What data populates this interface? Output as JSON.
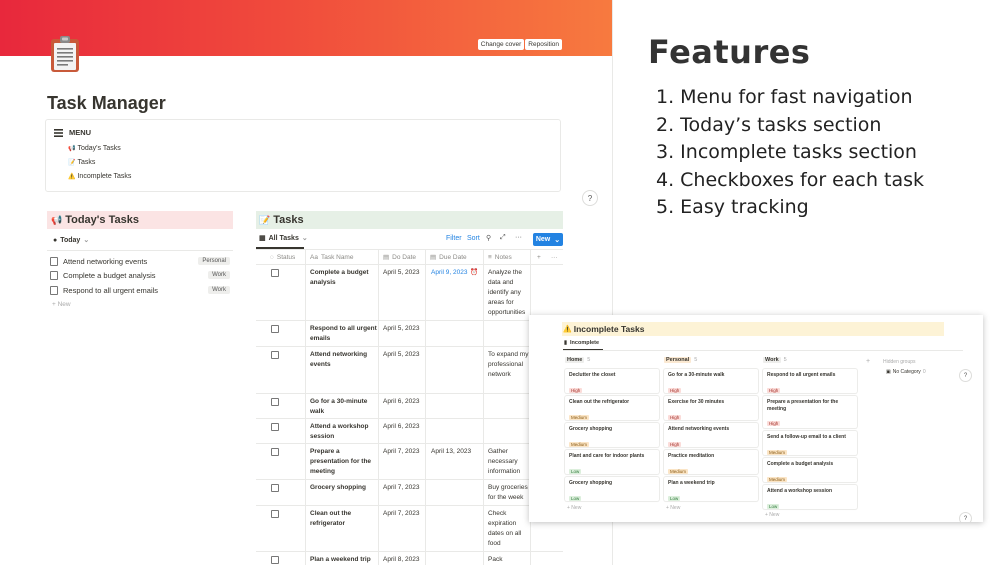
{
  "cover": {
    "change_cover": "Change cover",
    "reposition": "Reposition"
  },
  "page": {
    "title": "Task Manager"
  },
  "menu": {
    "label": "MENU",
    "links": [
      {
        "icon": "📢",
        "label": "Today's Tasks"
      },
      {
        "icon": "📝",
        "label": "Tasks"
      },
      {
        "icon": "⚠️",
        "label": "Incomplete Tasks"
      }
    ]
  },
  "help": "?",
  "today": {
    "icon": "📢",
    "title": "Today's Tasks",
    "filter": "Today",
    "rows": [
      {
        "name": "Attend networking events",
        "tag": "Personal"
      },
      {
        "name": "Complete a budget analysis",
        "tag": "Work"
      },
      {
        "name": "Respond to all urgent emails",
        "tag": "Work"
      }
    ],
    "new_label": "+ New"
  },
  "tasks": {
    "icon": "📝",
    "title": "Tasks",
    "view": "All Tasks",
    "filter": "Filter",
    "sort": "Sort",
    "new_button": "New",
    "columns": {
      "status": "Status",
      "name": "Task Name",
      "do_date": "Do Date",
      "due_date": "Due Date",
      "notes": "Notes",
      "plus": "+",
      "more": "···"
    },
    "rows": [
      {
        "name": "Complete a budget analysis",
        "do": "April 5, 2023",
        "due": "April 9, 2023",
        "notes": "Analyze the data and identify any areas for opportunities"
      },
      {
        "name": "Respond to all urgent emails",
        "do": "April 5, 2023",
        "due": "",
        "notes": ""
      },
      {
        "name": "Attend networking events",
        "do": "April 5, 2023",
        "due": "",
        "notes": "To expand my professional network"
      },
      {
        "name": "Go for a 30-minute walk",
        "do": "April 6, 2023",
        "due": "",
        "notes": ""
      },
      {
        "name": "Attend a workshop session",
        "do": "April 6, 2023",
        "due": "",
        "notes": ""
      },
      {
        "name": "Prepare a presentation for the meeting",
        "do": "April 7, 2023",
        "due": "April 13, 2023",
        "notes": "Gather necessary information"
      },
      {
        "name": "Grocery shopping",
        "do": "April 7, 2023",
        "due": "",
        "notes": "Buy groceries for the week"
      },
      {
        "name": "Clean out the refrigerator",
        "do": "April 7, 2023",
        "due": "",
        "notes": "Check expiration dates on all food"
      },
      {
        "name": "Plan a weekend trip",
        "do": "April 8, 2023",
        "due": "",
        "notes": "Pack"
      }
    ]
  },
  "features": {
    "title": "Features",
    "items": [
      "1. Menu for fast navigation",
      "2. Today’s tasks section",
      "3. Incomplete tasks section",
      "4. Checkboxes for each task",
      "5. Easy tracking"
    ]
  },
  "kanban": {
    "icon": "⚠️",
    "title": "Incomplete Tasks",
    "tab": "Incomplete",
    "hidden_groups": "Hidden groups",
    "no_category": "No Category",
    "no_category_count": "0",
    "new_label": "+ New",
    "columns": [
      {
        "title": "Home",
        "count": "5",
        "cards": [
          {
            "title": "Declutter the closet",
            "priority": "High"
          },
          {
            "title": "Clean out the refrigerator",
            "priority": "Medium"
          },
          {
            "title": "Grocery shopping",
            "priority": "Medium"
          },
          {
            "title": "Plant and care for indoor plants",
            "priority": "Low"
          },
          {
            "title": "Grocery shopping",
            "priority": "Low"
          }
        ]
      },
      {
        "title": "Personal",
        "count": "5",
        "cards": [
          {
            "title": "Go for a 30-minute walk",
            "priority": "High"
          },
          {
            "title": "Exercise for 30 minutes",
            "priority": "High"
          },
          {
            "title": "Attend networking events",
            "priority": "High"
          },
          {
            "title": "Practice meditation",
            "priority": "Medium"
          },
          {
            "title": "Plan a weekend trip",
            "priority": "Low"
          }
        ]
      },
      {
        "title": "Work",
        "count": "5",
        "cards": [
          {
            "title": "Respond to all urgent emails",
            "priority": "High"
          },
          {
            "title": "Prepare a presentation for the meeting",
            "priority": "High"
          },
          {
            "title": "Send a follow-up email to a client",
            "priority": "Medium"
          },
          {
            "title": "Complete a budget analysis",
            "priority": "Medium"
          },
          {
            "title": "Attend a workshop session",
            "priority": "Low"
          }
        ]
      }
    ]
  }
}
